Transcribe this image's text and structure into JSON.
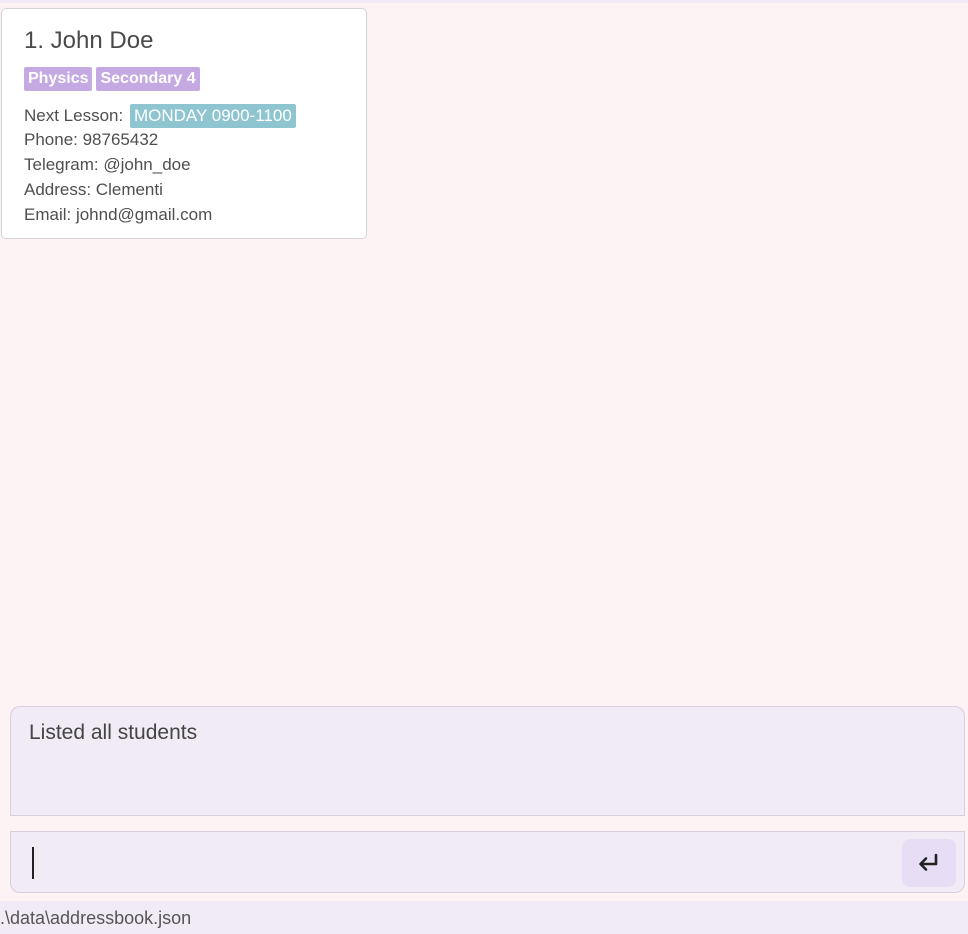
{
  "students": [
    {
      "index_name": "1. John Doe",
      "tags": [
        "Physics",
        "Secondary 4"
      ],
      "next_lesson_label": "Next Lesson:",
      "next_lesson_value": "MONDAY 0900-1100",
      "phone": "Phone: 98765432",
      "telegram": "Telegram: @john_doe",
      "address": "Address: Clementi",
      "email": "Email: johnd@gmail.com"
    }
  ],
  "result": {
    "text": "Listed all students"
  },
  "command": {
    "value": "",
    "submit_icon": "enter-icon"
  },
  "status": {
    "file_path": ".\\data\\addressbook.json"
  },
  "colors": {
    "background": "#fdf3f4",
    "panel": "#f1ebf5",
    "tag": "#c4a9e3",
    "lesson_chip": "#8ec5d1"
  }
}
